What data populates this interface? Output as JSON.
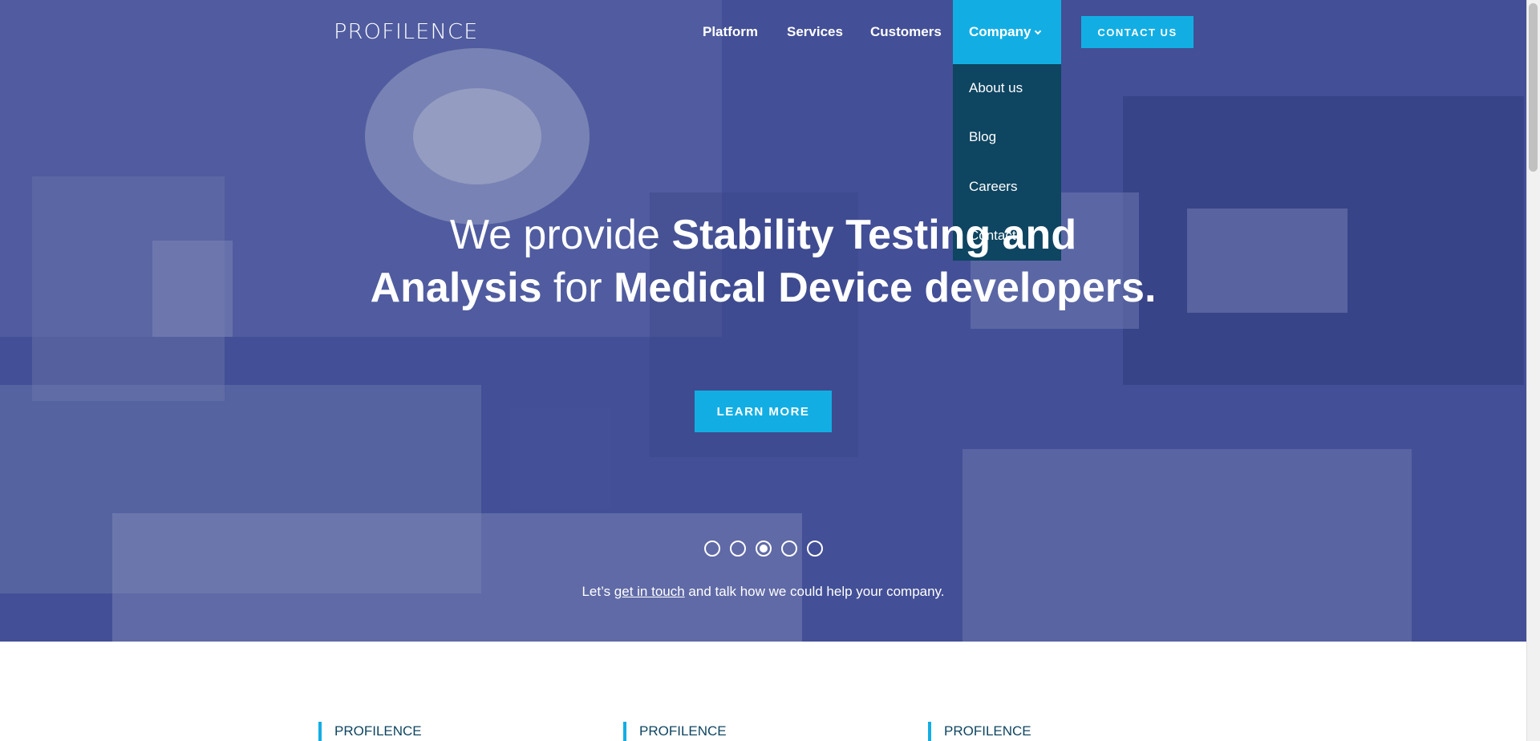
{
  "brand": {
    "logo_text": "PROFILENCE"
  },
  "nav": {
    "items": [
      "Platform",
      "Services",
      "Customers"
    ],
    "active_item": "Company",
    "dropdown": [
      "About us",
      "Blog",
      "Careers",
      "Contact"
    ],
    "contact_label": "CONTACT US"
  },
  "hero": {
    "headline": {
      "part1": "We provide ",
      "part2": "Stability Testing and Analysis",
      "part3": " for ",
      "part4": "Medical Device developers."
    },
    "learn_label": "LEARN MORE",
    "slides": {
      "count": 5,
      "active": 3
    },
    "cta": {
      "prefix": "Let’s ",
      "link": "get in touch",
      "suffix": " and talk how we could help your company."
    }
  },
  "features": [
    "PROFILENCE",
    "PROFILENCE",
    "PROFILENCE"
  ],
  "colors": {
    "accent": "#12aee3",
    "dropdown_bg": "#0e4561"
  },
  "icons": {
    "company_caret": "chevron-down-icon"
  }
}
